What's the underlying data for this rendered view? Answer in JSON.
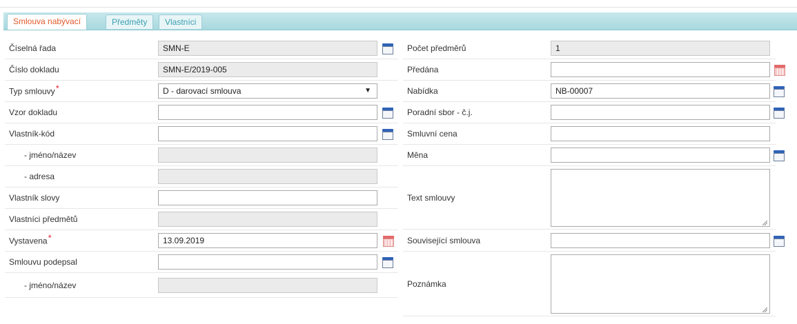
{
  "tabs": [
    {
      "label": "Smlouva nabývací",
      "active": true
    },
    {
      "label": "Předměty",
      "active": false
    },
    {
      "label": "Vlastníci",
      "active": false
    }
  ],
  "left": {
    "ciselna_rada": {
      "label": "Číselná řada",
      "value": "SMN-E"
    },
    "cislo_dokladu": {
      "label": "Číslo dokladu",
      "value": "SMN-E/2019-005"
    },
    "typ_smlouvy": {
      "label": "Typ smlouvy",
      "value": "D - darovací smlouva",
      "required": "*"
    },
    "vzor_dokladu": {
      "label": "Vzor dokladu",
      "value": ""
    },
    "vlastnik_kod": {
      "label": "Vlastník-kód",
      "value": ""
    },
    "jmeno_nazev": {
      "label": "- jméno/název",
      "value": ""
    },
    "adresa": {
      "label": "- adresa",
      "value": ""
    },
    "vlastnik_slovy": {
      "label": "Vlastník slovy",
      "value": ""
    },
    "vlastnici_predmetu": {
      "label": "Vlastníci předmětů",
      "value": ""
    },
    "vystavena": {
      "label": "Vystavena",
      "value": "13.09.2019",
      "required": "*"
    },
    "smlouvu_podepsal": {
      "label": "Smlouvu podepsal",
      "value": ""
    },
    "podepsal_jmeno": {
      "label": "- jméno/název",
      "value": ""
    }
  },
  "right": {
    "pocet_predmetu": {
      "label": "Počet předměrů",
      "value": "1"
    },
    "predana": {
      "label": "Předána",
      "value": ""
    },
    "nabidka": {
      "label": "Nabídka",
      "value": "NB-00007"
    },
    "poradni_sbor": {
      "label": "Poradní sbor - č.j.",
      "value": ""
    },
    "smluvni_cena": {
      "label": "Smluvní cena",
      "value": ""
    },
    "mena": {
      "label": "Měna",
      "value": ""
    },
    "text_smlouvy": {
      "label": "Text smlouvy",
      "value": ""
    },
    "souvisejici_smlouva": {
      "label": "Související smlouva",
      "value": ""
    },
    "poznamka": {
      "label": "Poznámka",
      "value": ""
    }
  },
  "colors": {
    "tab_active_text": "#e05a2b",
    "tab_text": "#3a9fb1",
    "tabbar": "#a7d8de",
    "required": "#e0283a",
    "lookup_icon": "#2f63b8",
    "calendar_icon": "#e36a6a"
  }
}
